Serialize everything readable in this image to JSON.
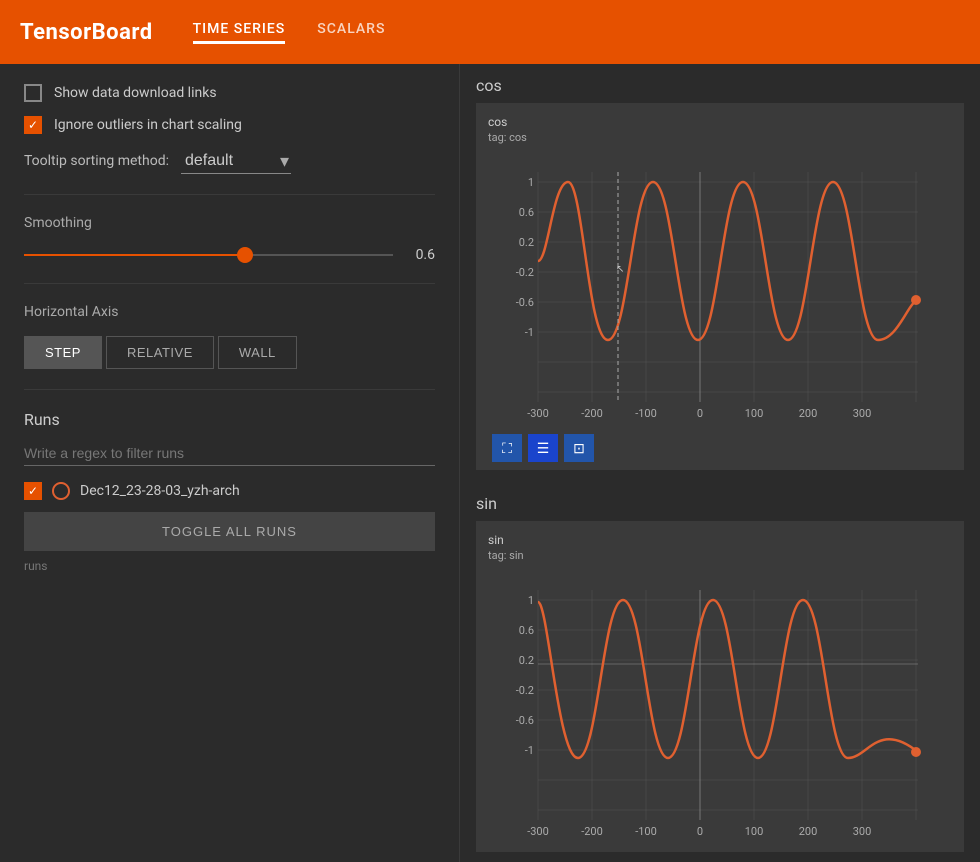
{
  "header": {
    "logo": "TensorBoard",
    "nav": [
      {
        "label": "TIME SERIES",
        "active": true
      },
      {
        "label": "SCALARS",
        "active": false
      }
    ]
  },
  "sidebar": {
    "show_download_label": "Show data download links",
    "ignore_outliers_label": "Ignore outliers in chart scaling",
    "show_download_checked": false,
    "ignore_outliers_checked": true,
    "tooltip_label": "Tooltip sorting method:",
    "tooltip_value": "default",
    "smoothing_label": "Smoothing",
    "smoothing_value": "0.6",
    "smoothing_percent": 60,
    "axis_label": "Horizontal Axis",
    "axis_options": [
      "STEP",
      "RELATIVE",
      "WALL"
    ],
    "axis_active": "STEP",
    "runs_title": "Runs",
    "filter_placeholder": "Write a regex to filter runs",
    "run_name": "Dec12_23-28-03_yzh-arch",
    "toggle_all_label": "TOGGLE ALL RUNS",
    "runs_footer": "runs"
  },
  "charts": [
    {
      "section_title": "cos",
      "inner_title": "cos",
      "inner_tag": "tag: cos",
      "x_labels": [
        "-300",
        "-200",
        "-100",
        "0",
        "100",
        "200",
        "300"
      ],
      "y_labels": [
        "1",
        "0.6",
        "0.2",
        "-0.2",
        "-0.6",
        "-1"
      ],
      "type": "cos"
    },
    {
      "section_title": "sin",
      "inner_title": "sin",
      "inner_tag": "tag: sin",
      "x_labels": [
        "-300",
        "-200",
        "-100",
        "0",
        "100",
        "200",
        "300"
      ],
      "y_labels": [
        "1",
        "0.6",
        "0.2",
        "-0.2",
        "-0.6",
        "-1"
      ],
      "type": "sin"
    }
  ],
  "icons": {
    "expand": "⛶",
    "list": "☰",
    "select": "⊡"
  }
}
